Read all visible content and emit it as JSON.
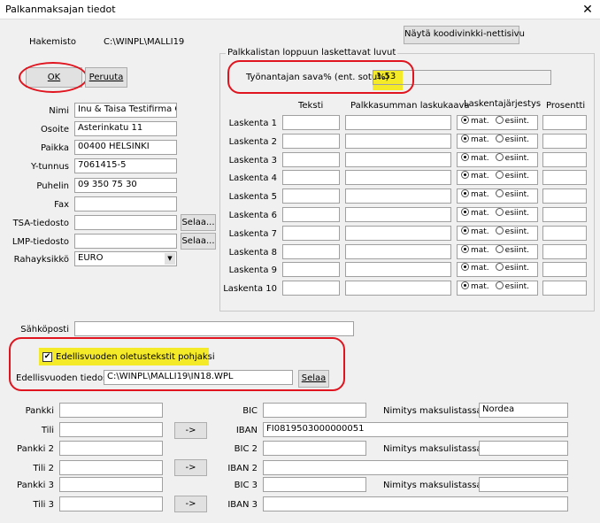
{
  "window": {
    "title": "Palkanmaksajan tiedot",
    "close_glyph": "✕"
  },
  "hakemisto": {
    "label": "Hakemisto",
    "value": "C:\\WINPL\\MALLI19"
  },
  "koodi_button": "Näytä koodivinkki-nettisivu",
  "ok_button": "OK",
  "cancel_button": "Peruuta",
  "company": {
    "nimi_label": "Nimi",
    "nimi": "Inu & Taisa Testifirma Oy",
    "osoite_label": "Osoite",
    "osoite": "Asterinkatu 11",
    "paikka_label": "Paikka",
    "paikka": "00400 HELSINKI",
    "ytunnus_label": "Y-tunnus",
    "ytunnus": "7061415-5",
    "puhelin_label": "Puhelin",
    "puhelin": "09 350 75 30",
    "fax_label": "Fax",
    "fax": "",
    "tsa_label": "TSA-tiedosto",
    "tsa": "",
    "lmp_label": "LMP-tiedosto",
    "lmp": "",
    "browse": "Selaa...",
    "rahayksikko_label": "Rahayksikkö",
    "rahayksikko": "EURO"
  },
  "calc_group": {
    "title": "Palkkalistan loppuun laskettavat luvut",
    "employer_label": "Työnantajan sava% (ent. sotu%)",
    "employer_value": "1,53",
    "headers": {
      "teksti": "Teksti",
      "kaava": "Palkkasumman laskukaava",
      "jarjestys": "Laskentajärjestys",
      "prosentti": "Prosentti"
    },
    "mat": "mat.",
    "esiint": "esiint.",
    "rows": [
      {
        "label": "Laskenta 1"
      },
      {
        "label": "Laskenta 2"
      },
      {
        "label": "Laskenta 3"
      },
      {
        "label": "Laskenta 4"
      },
      {
        "label": "Laskenta 5"
      },
      {
        "label": "Laskenta 6"
      },
      {
        "label": "Laskenta 7"
      },
      {
        "label": "Laskenta 8"
      },
      {
        "label": "Laskenta 9"
      },
      {
        "label": "Laskenta 10"
      }
    ]
  },
  "sahkoposti_label": "Sähköposti",
  "sahkoposti": "",
  "prev_year": {
    "checkbox_label": "Edellisvuoden oletustekstit pohjaksi",
    "checked": true,
    "file_label": "Edellisvuoden tiedosto",
    "file_value": "C:\\WINPL\\MALLI19\\IN18.WPL",
    "browse": "Selaa"
  },
  "bank": {
    "arrow": "->",
    "pankki1": "Pankki",
    "tili1": "Tili",
    "pankki2": "Pankki 2",
    "tili2": "Tili 2",
    "pankki3": "Pankki 3",
    "tili3": "Tili 3",
    "bic1": "BIC",
    "iban1": "IBAN",
    "bic2": "BIC 2",
    "iban2": "IBAN 2",
    "bic3": "BIC 3",
    "iban3": "IBAN 3",
    "iban1_value": "FI0819503000000051",
    "nimitys_label": "Nimitys maksulistassa =",
    "nimitys1_value": "Nordea"
  },
  "colors": {
    "highlight": "#f4ea28",
    "annotation": "#e0141e"
  }
}
